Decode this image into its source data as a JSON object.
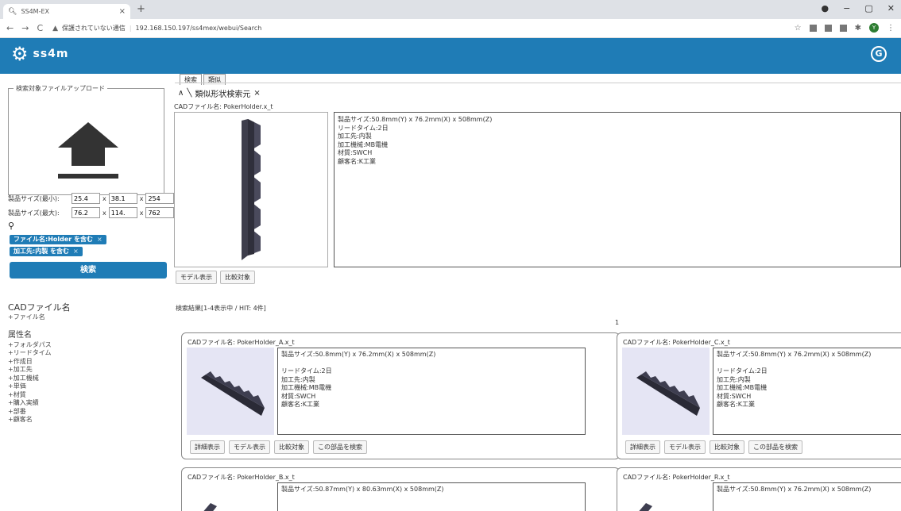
{
  "browser": {
    "tab_title": "SS4M-EX",
    "tab_close": "×",
    "new_tab": "+",
    "security_label": "保護されていない通信",
    "url": "192.168.150.197/ss4mex/webui/Search",
    "window_minimize": "−",
    "window_maximize": "▢",
    "window_close": "✕",
    "avatar_letter": "Y"
  },
  "app": {
    "brand": "ss4m",
    "header_badge": "G",
    "accent_color": "#1f7cb6"
  },
  "upload": {
    "legend": "検索対象ファイルアップロード"
  },
  "size_filter": {
    "min_label": "製品サイズ(最小):",
    "max_label": "製品サイズ(最大):",
    "min_values": [
      "25.4",
      "38.1",
      "254"
    ],
    "max_values": [
      "76.2",
      "114.",
      "762"
    ],
    "separator": "x"
  },
  "chips": [
    {
      "label": "ファイル名:Holder を含む",
      "close": "×"
    },
    {
      "label": "加工先:内製 を含む",
      "close": "×"
    }
  ],
  "search_button": "検索",
  "facets": {
    "cad_head": "CADファイル名",
    "cad_items": [
      "+ファイル名"
    ],
    "attr_head": "属性名",
    "attr_items": [
      "+フォルダパス",
      "+リードタイム",
      "+作成日",
      "+加工先",
      "+加工機械",
      "+単価",
      "+材質",
      "+購入実績",
      "+部番",
      "+顧客名"
    ]
  },
  "tabs": [
    "検索",
    "類似"
  ],
  "query": {
    "collapse": "∧",
    "title": "類似形状検索元",
    "close": "×",
    "file_label": "CADファイル名: PokerHolder.x_t",
    "info": [
      "製品サイズ:50.8mm(Y) x 76.2mm(X) x 508mm(Z)",
      "リードタイム:2日",
      "加工先:内製",
      "加工機械:MB電機",
      "材質:SWCH",
      "顧客名:K工業"
    ],
    "buttons": [
      "モデル表示",
      "比較対象"
    ]
  },
  "results": {
    "summary": "検索結果[1-4表示中 / HIT: 4件]",
    "page": "1",
    "cards": [
      {
        "title": "CADファイル名: PokerHolder_A.x_t",
        "info": [
          "製品サイズ:50.8mm(Y) x 76.2mm(X) x 508mm(Z)",
          "",
          "リードタイム:2日",
          "加工先:内製",
          "加工機械:MB電機",
          "材質:SWCH",
          "顧客名:K工業"
        ],
        "buttons": [
          "詳細表示",
          "モデル表示",
          "比較対象",
          "この部品を検索"
        ]
      },
      {
        "title": "CADファイル名: PokerHolder_C.x_t",
        "info": [
          "製品サイズ:50.8mm(Y) x 76.2mm(X) x 508mm(Z)",
          "",
          "リードタイム:2日",
          "加工先:内製",
          "加工機械:MB電機",
          "材質:SWCH",
          "顧客名:K工業"
        ],
        "buttons": [
          "詳細表示",
          "モデル表示",
          "比較対象",
          "この部品を検索"
        ]
      },
      {
        "title": "CADファイル名: PokerHolder_B.x_t",
        "info": [
          "製品サイズ:50.87mm(Y) x 80.63mm(X) x 508mm(Z)"
        ],
        "buttons": []
      },
      {
        "title": "CADファイル名: PokerHolder_R.x_t",
        "info": [
          "製品サイズ:50.8mm(Y) x 76.2mm(X) x 508mm(Z)"
        ],
        "buttons": []
      }
    ]
  }
}
